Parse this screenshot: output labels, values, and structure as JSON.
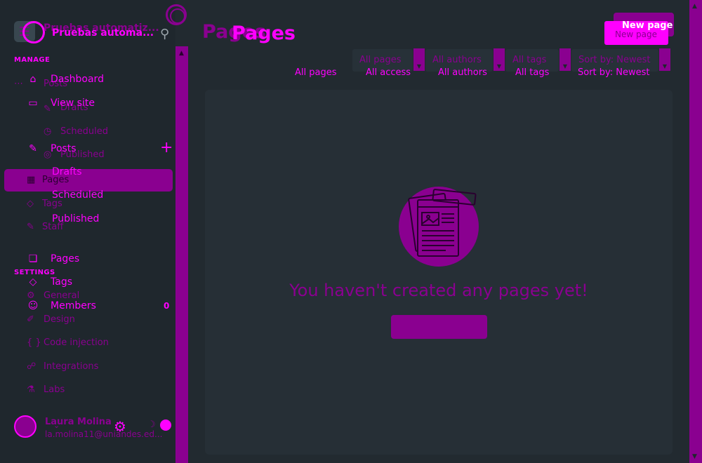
{
  "site": {
    "title_back": "Pruebas automatiz...",
    "title": "Pruebas automa..."
  },
  "sidebar": {
    "manage_label": "MANAGE",
    "settings_label": "SETTINGS",
    "items": [
      {
        "label": "Dashboard",
        "icon": "house-icon"
      },
      {
        "label": "View site",
        "icon": "window-icon"
      },
      {
        "label": "Posts",
        "icon": "pencil-square-icon"
      },
      {
        "label": "Drafts"
      },
      {
        "label": "Scheduled"
      },
      {
        "label": "Published"
      },
      {
        "label": "Pages",
        "icon": "pages-icon"
      },
      {
        "label": "Tags",
        "icon": "tag-icon"
      },
      {
        "label": "Members",
        "icon": "members-icon",
        "count": "0"
      }
    ],
    "ghost_items": [
      {
        "label": "Posts"
      },
      {
        "label": "Drafts"
      },
      {
        "label": "Scheduled"
      },
      {
        "label": "Published"
      },
      {
        "label": "Pages"
      },
      {
        "label": "Tags"
      },
      {
        "label": "Staff"
      },
      {
        "label": "General"
      },
      {
        "label": "Design"
      },
      {
        "label": "Code injection"
      },
      {
        "label": "Integrations"
      },
      {
        "label": "Labs"
      }
    ]
  },
  "user": {
    "name": "Laura Molina",
    "email": "la.molina11@uniandes.ed..."
  },
  "header": {
    "title_back": "Pages",
    "title": "Pages",
    "new_button": "New page",
    "new_button_back": "New page"
  },
  "filters": {
    "back": [
      "All pages",
      "All authors",
      "All tags",
      "Sort by: Newest"
    ],
    "front": [
      "All pages",
      "All access",
      "All authors",
      "All tags",
      "Sort by: Newest"
    ]
  },
  "empty_state": {
    "message": "You haven't created any pages yet!"
  },
  "colors": {
    "accent": "#ff00ff",
    "accent_dark": "#8a0090",
    "background": "#222a30",
    "sidebar": "#1f272d"
  }
}
